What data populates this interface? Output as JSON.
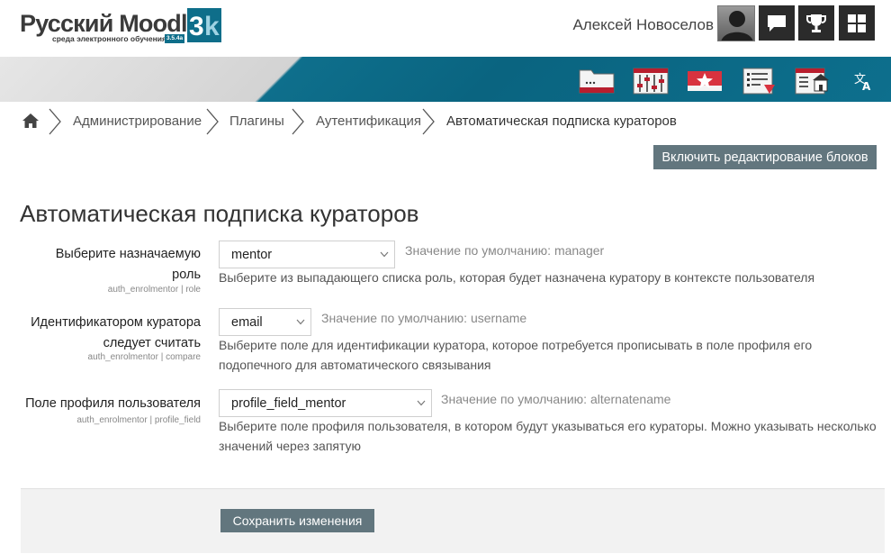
{
  "header": {
    "logo_title": "Русский Moodle",
    "logo_subtitle": "среда электронного обучения",
    "logo_version": "3.5.4a",
    "logo_badge": "3k",
    "user_name": "Алексей Новоселов"
  },
  "breadcrumb": {
    "items": [
      "Администрирование",
      "Плагины",
      "Аутентификация",
      "Автоматическая подписка кураторов"
    ]
  },
  "toolbar": {
    "blocks_button": "Включить редактирование блоков"
  },
  "page": {
    "title": "Автоматическая подписка кураторов"
  },
  "settings": [
    {
      "label": "Выберите назначаемую роль",
      "label_line1": "Выберите назначаемую",
      "label_line2": "роль",
      "key": "auth_enrolmentor | role",
      "value": "mentor",
      "default": "Значение по умолчанию: manager",
      "description_line1": "Выберите из выпадающего списка роль, которая будет назначена куратору в контексте пользователя",
      "description_line2": ""
    },
    {
      "label": "Идентификатором куратора следует считать",
      "label_line1": "Идентификатором куратора",
      "label_line2": "следует считать",
      "key": "auth_enrolmentor | compare",
      "value": "email",
      "default": "Значение по умолчанию: username",
      "description_line1": "Выберите поле для идентификации куратора, которое потребуется прописывать в поле профиля его",
      "description_line2": "подопечного для автоматического связывания"
    },
    {
      "label": "Поле профиля пользователя",
      "label_line1": "Поле профиля пользователя",
      "label_line2": "",
      "key": "auth_enrolmentor | profile_field",
      "value": "profile_field_mentor",
      "default": "Значение по умолчанию: alternatename",
      "description_line1": "Выберите поле профиля пользователя, в котором будут указываться его кураторы. Можно указывать несколько",
      "description_line2": "значений через запятую"
    }
  ],
  "footer": {
    "save_button": "Сохранить изменения"
  },
  "icons": {
    "header_buttons": [
      "messages-icon",
      "trophy-icon",
      "apps-grid-icon"
    ],
    "tools": [
      "folder-icon",
      "sliders-icon",
      "featured-star-icon",
      "gradebook-icon",
      "home-courses-icon",
      "translate-icon"
    ]
  },
  "colors": {
    "band_teal": "#0e6f8c",
    "button_gray": "#62767e",
    "header_dark": "#2b2b2b"
  }
}
